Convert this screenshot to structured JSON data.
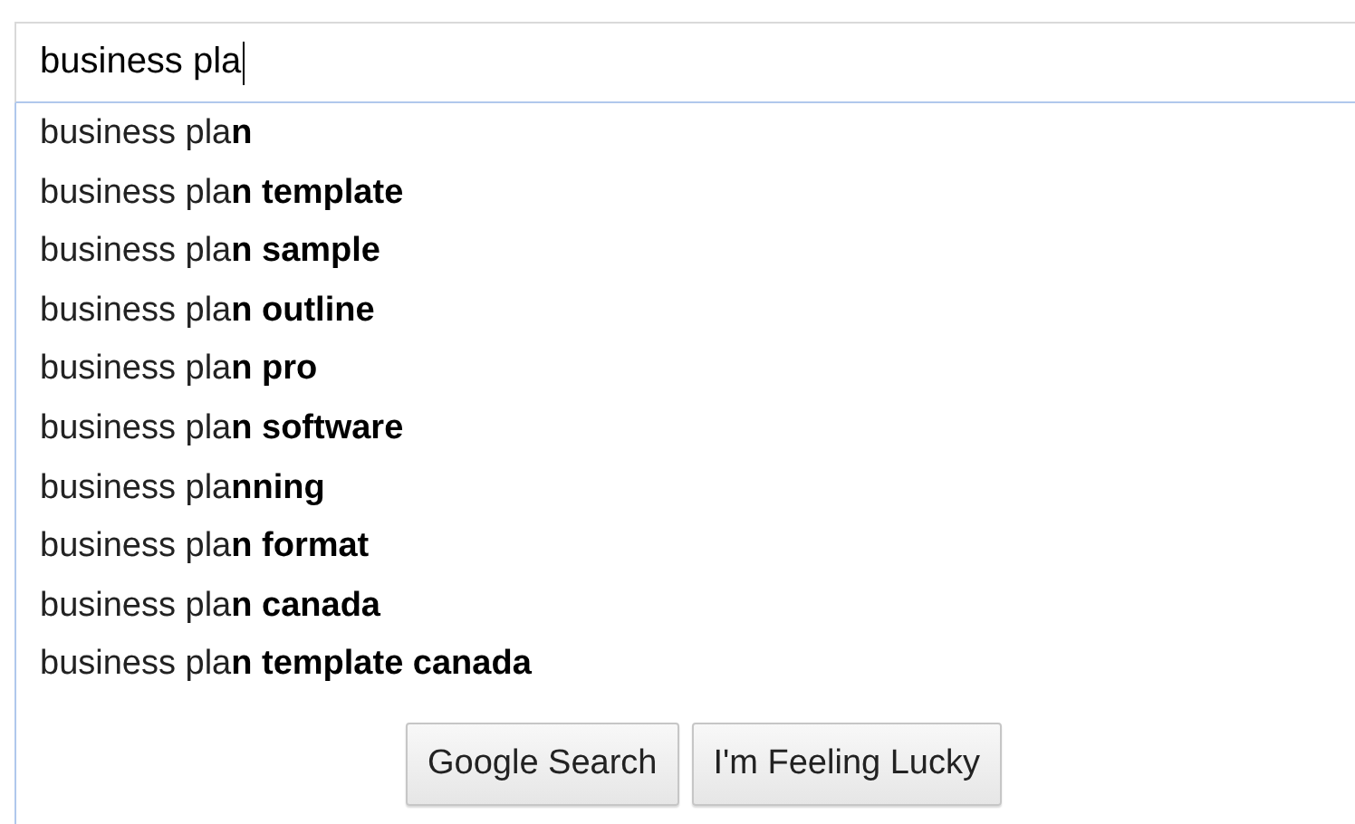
{
  "search": {
    "value": "business pla"
  },
  "suggestions": [
    "business pla**n**",
    "business pla**n template**",
    "business pla**n sample**",
    "business pla**n outline**",
    "business pla**n pro**",
    "business pla**n software**",
    "business pla**nning**",
    "business pla**n format**",
    "business pla**n canada**",
    "business pla**n template canada**"
  ],
  "buttons": [
    "Google Search",
    "I'm Feeling Lucky"
  ]
}
